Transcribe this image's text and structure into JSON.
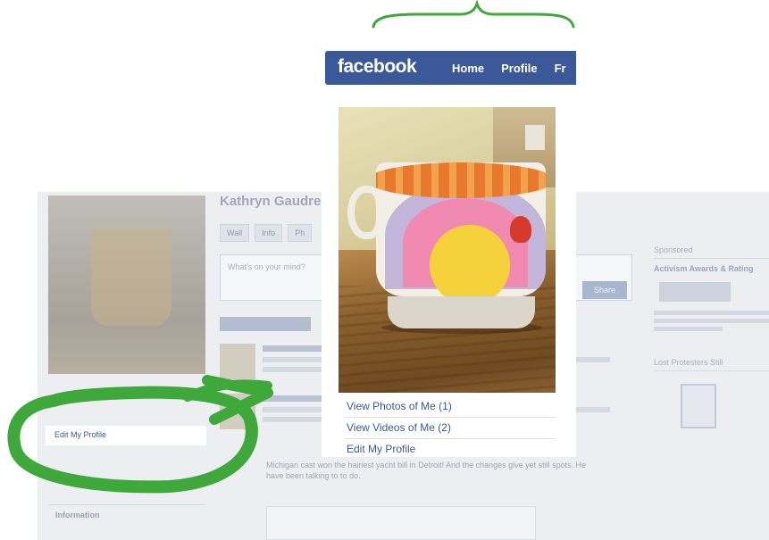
{
  "brand": {
    "logo_text": "facebook",
    "bar_color": "#3b5998",
    "annotation_color": "#3ea83a"
  },
  "nav": {
    "items": [
      "Home",
      "Profile",
      "Fr"
    ]
  },
  "profile_links": [
    {
      "label": "View Photos of Me (1)"
    },
    {
      "label": "View Videos of Me (2)"
    },
    {
      "label": "Edit My Profile"
    }
  ],
  "background_page": {
    "name": "Kathryn Gaudreau",
    "tabs": [
      "Wall",
      "Info",
      "Ph"
    ],
    "status_placeholder": "What's on your mind?",
    "share_label": "Share",
    "edit_profile_link": "Edit My Profile",
    "left_section_heading": "Information",
    "right_heading": "Sponsored",
    "right_ad_title": "Activism Awards & Rating",
    "right_section_two": "Lost Protesters Still",
    "long_post": "Michigan cast won the hairiest yacht bill in Detroit! And the changes give yet still spots. He have been talking to to do."
  }
}
